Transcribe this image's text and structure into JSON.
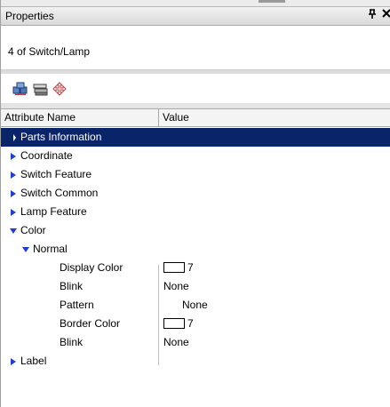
{
  "panel": {
    "title": "Properties",
    "pin_glyph": "Ф",
    "close_glyph": "✖"
  },
  "selection": {
    "text": "4 of Switch/Lamp"
  },
  "toolbar": {
    "icons": [
      "group-parts-icon",
      "sort-list-icon",
      "move-icon"
    ]
  },
  "grid": {
    "headers": {
      "name": "Attribute Name",
      "value": "Value"
    },
    "rows": [
      {
        "label": "Parts Information",
        "value": ""
      },
      {
        "label": "Coordinate",
        "value": ""
      },
      {
        "label": "Switch Feature",
        "value": ""
      },
      {
        "label": "Switch Common",
        "value": ""
      },
      {
        "label": "Lamp Feature",
        "value": ""
      },
      {
        "label": "Color",
        "value": ""
      },
      {
        "label": "Normal",
        "value": ""
      },
      {
        "label": "Display Color",
        "value": "7"
      },
      {
        "label": "Blink",
        "value": "None"
      },
      {
        "label": "Pattern",
        "value": "None"
      },
      {
        "label": "Border Color",
        "value": "7"
      },
      {
        "label": "Blink",
        "value": "None"
      },
      {
        "label": "Label",
        "value": ""
      }
    ]
  },
  "colors": {
    "selection": "#0a246a",
    "expander": "#1f3fd4"
  }
}
